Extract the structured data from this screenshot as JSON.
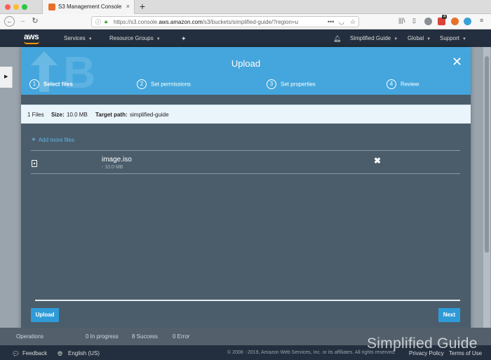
{
  "browser": {
    "tab_title": "S3 Management Console",
    "new_tab": "+",
    "close_tab": "×",
    "url_host": "https://s3.console.",
    "url_domain": "aws.amazon.com",
    "url_path": "/s3/buckets/simplified-guide/?region=u",
    "ext_badge": "4"
  },
  "aws_header": {
    "logo": "aws",
    "menu": [
      {
        "label": "Services"
      },
      {
        "label": "Resource Groups"
      }
    ],
    "account": "Simplified Guide",
    "region": "Global",
    "support": "Support"
  },
  "modal": {
    "title": "Upload",
    "steps": [
      {
        "num": "1",
        "label": "Select files",
        "active": true
      },
      {
        "num": "2",
        "label": "Set permissions",
        "active": false
      },
      {
        "num": "3",
        "label": "Set properties",
        "active": false
      },
      {
        "num": "4",
        "label": "Review",
        "active": false
      }
    ],
    "summary": {
      "files": "1 Files",
      "size_label": "Size:",
      "size_value": "10.0 MB",
      "path_label": "Target path:",
      "path_value": "simplified-guide"
    },
    "add_more": "Add more files",
    "file": {
      "name": "image.iso",
      "size": "- 10.0 MB"
    },
    "upload_button": "Upload",
    "next_button": "Next"
  },
  "operations": {
    "label": "Operations",
    "in_progress": "0 In progress",
    "success": "8 Success",
    "error": "0 Error"
  },
  "footer": {
    "feedback": "Feedback",
    "language": "English (US)",
    "copyright": "© 2008 - 2019, Amazon Web Services, Inc. or its affiliates. All rights reserved.",
    "privacy": "Privacy Policy",
    "terms": "Terms of Use"
  },
  "watermark": "Simplified Guide",
  "colors": {
    "modal_header": "#44a6dc",
    "modal_body": "#4b5d6b",
    "button": "#2e9bd8",
    "aws_bar": "#232f3e"
  }
}
